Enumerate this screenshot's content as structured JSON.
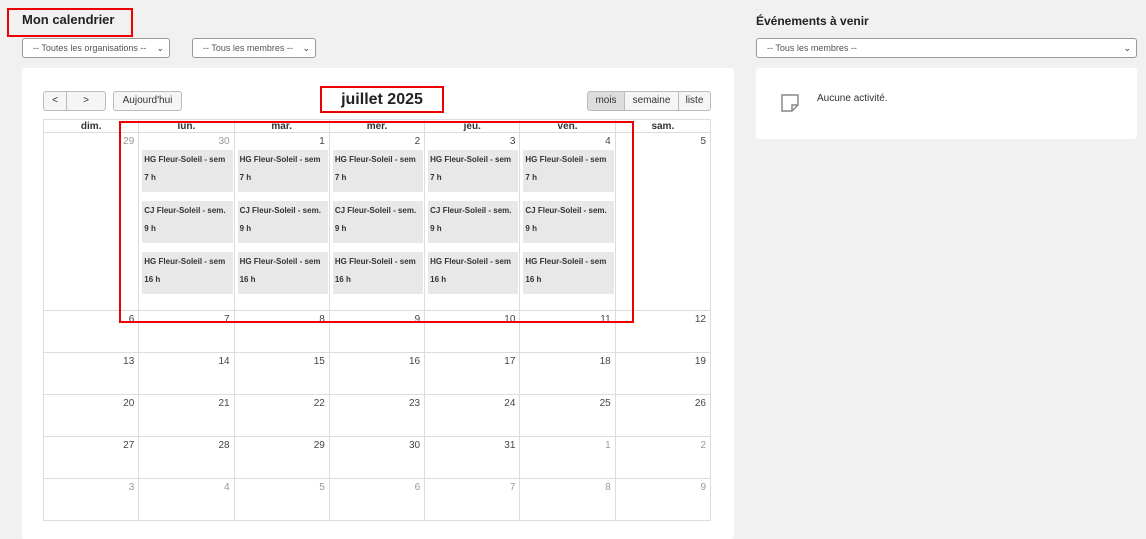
{
  "header": {
    "title": "Mon calendrier"
  },
  "filters": {
    "organisation": "-- Toutes les organisations --",
    "membres": "-- Tous les membres --"
  },
  "toolbar": {
    "prev": "<",
    "next": ">",
    "today": "Aujourd'hui",
    "month_title": "juillet 2025",
    "views": [
      "mois",
      "semaine",
      "liste"
    ],
    "active_view": "mois"
  },
  "weekdays": [
    "dim.",
    "lun.",
    "mar.",
    "mer.",
    "jeu.",
    "ven.",
    "sam."
  ],
  "weeks": [
    [
      "29",
      "30",
      "1",
      "2",
      "3",
      "4",
      "5"
    ],
    [
      "6",
      "7",
      "8",
      "9",
      "10",
      "11",
      "12"
    ],
    [
      "13",
      "14",
      "15",
      "16",
      "17",
      "18",
      "19"
    ],
    [
      "20",
      "21",
      "22",
      "23",
      "24",
      "25",
      "26"
    ],
    [
      "27",
      "28",
      "29",
      "30",
      "31",
      "1",
      "2"
    ],
    [
      "3",
      "4",
      "5",
      "6",
      "7",
      "8",
      "9"
    ]
  ],
  "events": [
    {
      "title": "HG Fleur-Soleil - sem",
      "time": "7 h"
    },
    {
      "title": "CJ Fleur-Soleil - sem.",
      "time": "9 h"
    },
    {
      "title": "HG Fleur-Soleil - sem",
      "time": "16 h"
    }
  ],
  "sidebar": {
    "title": "Événements à venir",
    "membres": "-- Tous les membres --",
    "empty": "Aucune activité."
  }
}
